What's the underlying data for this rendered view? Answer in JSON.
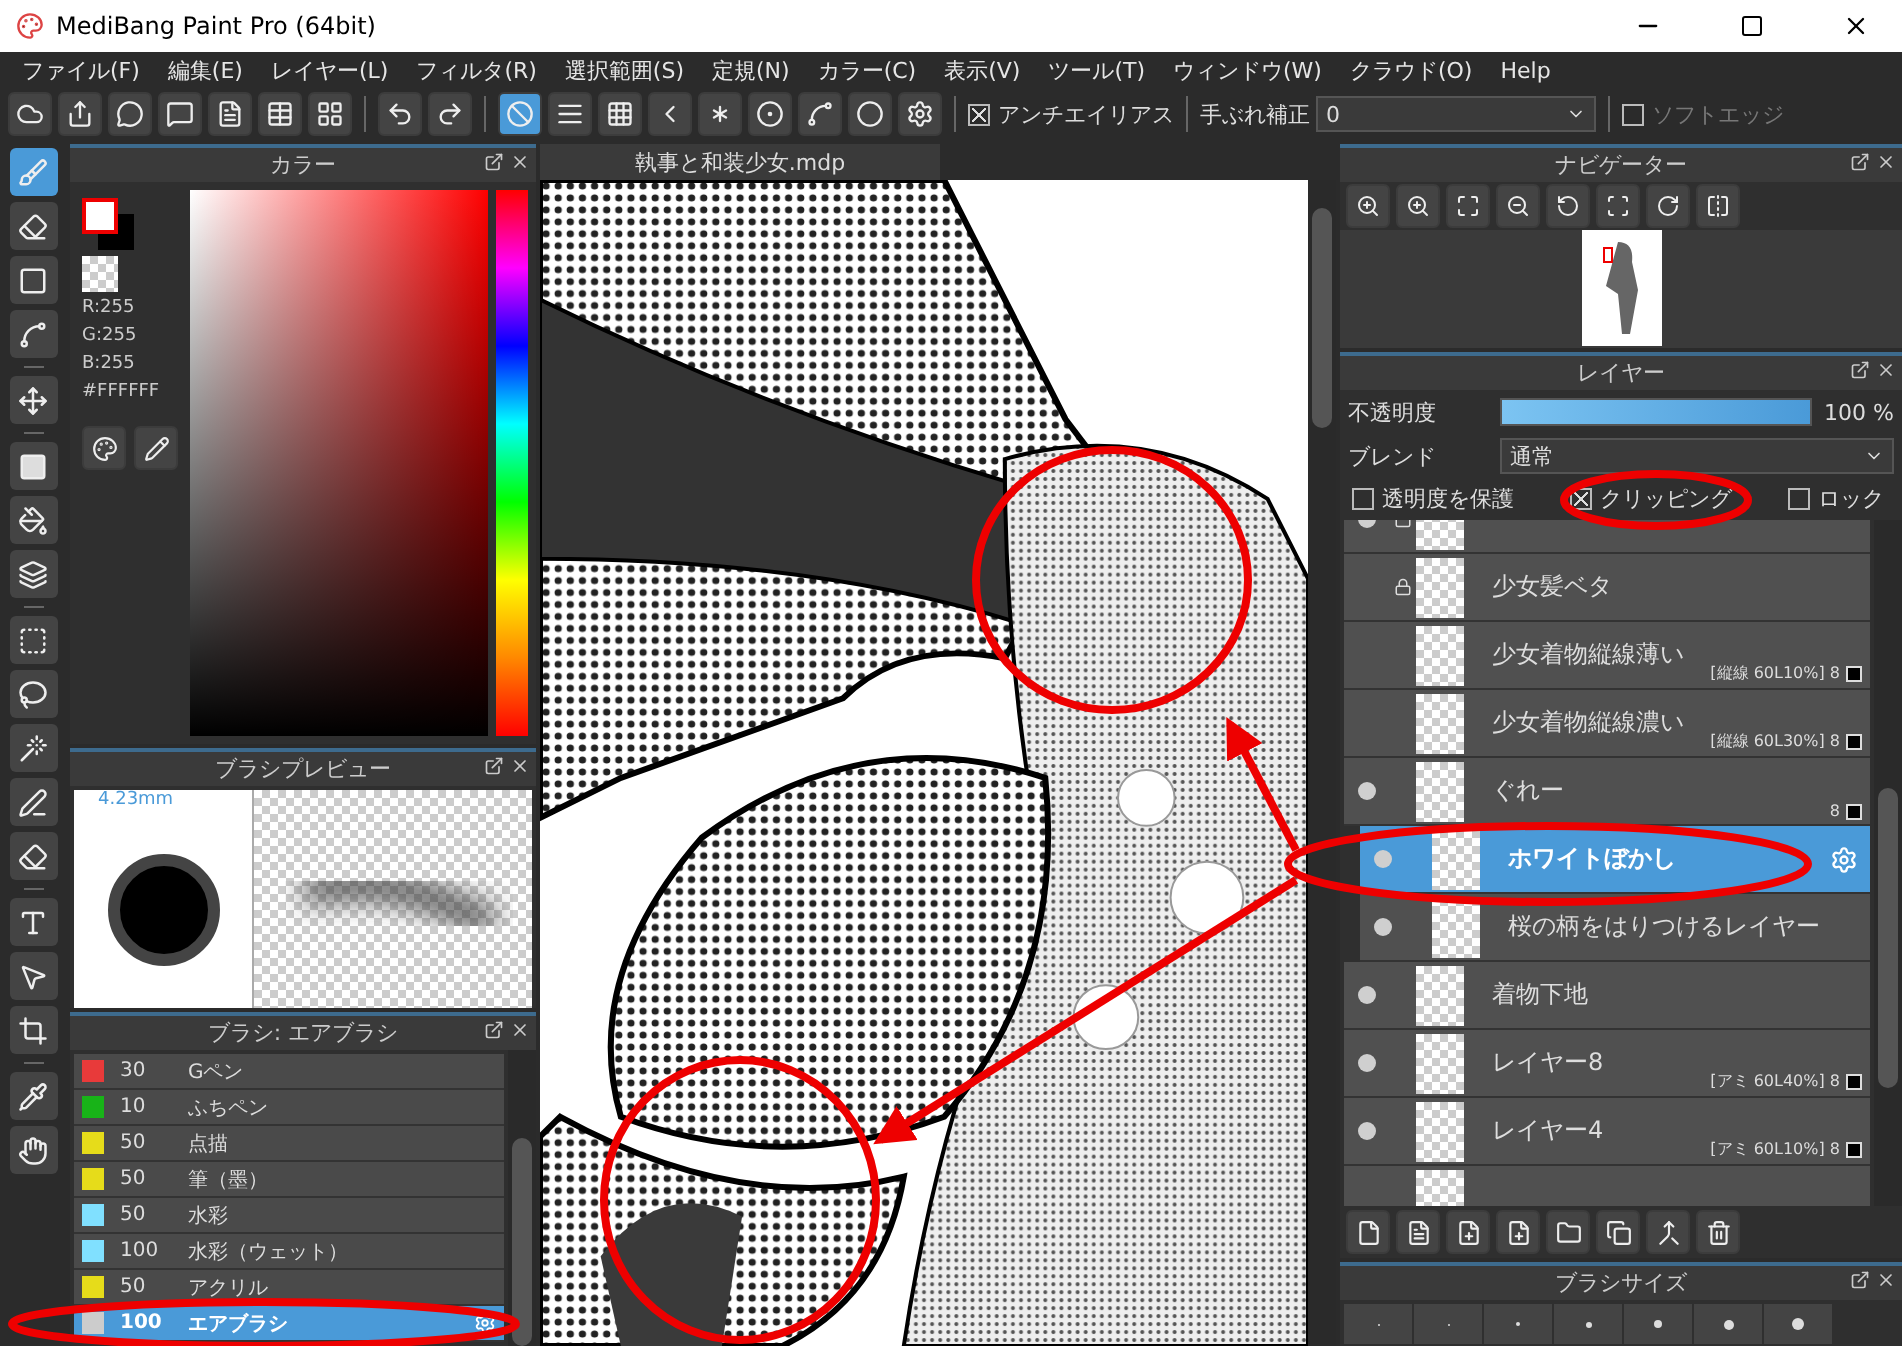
{
  "window": {
    "title": "MediBang Paint Pro (64bit)"
  },
  "menu": [
    "ファイル(F)",
    "編集(E)",
    "レイヤー(L)",
    "フィルタ(R)",
    "選択範囲(S)",
    "定規(N)",
    "カラー(C)",
    "表示(V)",
    "ツール(T)",
    "ウィンドウ(W)",
    "クラウド(O)",
    "Help"
  ],
  "toolbar": {
    "snaps": [
      {
        "kind": "off",
        "selected": true
      },
      {
        "kind": "parallel",
        "selected": false
      },
      {
        "kind": "grid",
        "selected": false
      },
      {
        "kind": "perspective",
        "selected": false
      },
      {
        "kind": "radial",
        "selected": false
      },
      {
        "kind": "concentric",
        "selected": false
      },
      {
        "kind": "curve",
        "selected": false
      },
      {
        "kind": "circle",
        "selected": false
      },
      {
        "kind": "settings",
        "selected": false
      }
    ],
    "antialias": {
      "label": "アンチエイリアス",
      "checked": true
    },
    "stabilizer": {
      "label": "手ぶれ補正",
      "value": "0"
    },
    "soft_edge": {
      "label": "ソフトエッジ",
      "checked": false
    }
  },
  "tool_groups": [
    [
      {
        "kind": "brush",
        "selected": true
      },
      {
        "kind": "eraser",
        "selected": false
      },
      {
        "kind": "dot",
        "selected": false
      },
      {
        "kind": "line",
        "selected": false
      }
    ],
    [
      {
        "kind": "move",
        "selected": false
      }
    ],
    [
      {
        "kind": "fill",
        "selected": false
      },
      {
        "kind": "bucket",
        "selected": false
      },
      {
        "kind": "gradient",
        "selected": false
      }
    ],
    [
      {
        "kind": "select",
        "selected": false
      },
      {
        "kind": "lasso",
        "selected": false
      },
      {
        "kind": "wand",
        "selected": false
      },
      {
        "kind": "select-pen",
        "selected": false
      },
      {
        "kind": "select-eraser",
        "selected": false
      }
    ],
    [
      {
        "kind": "text",
        "selected": false
      },
      {
        "kind": "operation",
        "selected": false
      },
      {
        "kind": "divide",
        "selected": false
      }
    ],
    [
      {
        "kind": "eyedropper",
        "selected": false
      },
      {
        "kind": "hand",
        "selected": false
      }
    ]
  ],
  "color_panel": {
    "title": "カラー",
    "r": "R:255",
    "g": "G:255",
    "b": "B:255",
    "hex": "#FFFFFF"
  },
  "brush_preview": {
    "title": "ブラシプレビュー",
    "size": "4.23mm"
  },
  "brush_list": {
    "title": "ブラシ: エアブラシ",
    "items": [
      {
        "color": "#e83a3a",
        "size": "30",
        "name": "Gペン",
        "selected": false
      },
      {
        "color": "#18b318",
        "size": "10",
        "name": "ふちペン",
        "selected": false
      },
      {
        "color": "#e6dc1a",
        "size": "50",
        "name": "点描",
        "selected": false
      },
      {
        "color": "#e6dc1a",
        "size": "50",
        "name": "筆（墨）",
        "selected": false
      },
      {
        "color": "#80e0ff",
        "size": "50",
        "name": "水彩",
        "selected": false
      },
      {
        "color": "#80e0ff",
        "size": "100",
        "name": "水彩（ウェット）",
        "selected": false
      },
      {
        "color": "#e6dc1a",
        "size": "50",
        "name": "アクリル",
        "selected": false
      },
      {
        "color": "#cccccc",
        "size": "100",
        "name": "エアブラシ",
        "selected": true
      }
    ]
  },
  "canvas": {
    "tab": "執事と和装少女.mdp"
  },
  "navigator": {
    "title": "ナビゲーター"
  },
  "layers": {
    "title": "レイヤー",
    "opacity_label": "不透明度",
    "opacity": {
      "level": 1
    },
    "opacity_value": "100 %",
    "blend_label": "ブレンド",
    "blend_value": "通常",
    "options": [
      {
        "label": "透明度を保護",
        "checked": false
      },
      {
        "label": "クリッピング",
        "checked": true
      },
      {
        "label": "ロック",
        "checked": false
      }
    ],
    "items": [
      {
        "visible": true,
        "locked": true,
        "clipped": false,
        "selected": false
      },
      {
        "name": "少女髪ベタ",
        "visible": false,
        "locked": true,
        "clipped": false,
        "selected": false
      },
      {
        "name": "少女着物縦線薄い",
        "visible": false,
        "locked": false,
        "clipped": false,
        "selected": false,
        "tag": "[縦線 60L10%] 8"
      },
      {
        "name": "少女着物縦線濃い",
        "visible": false,
        "locked": false,
        "clipped": false,
        "selected": false,
        "tag": "[縦線 60L30%] 8"
      },
      {
        "name": "ぐれー",
        "visible": true,
        "locked": false,
        "clipped": false,
        "selected": false,
        "tag": "8"
      },
      {
        "name": "ホワイトぼかし",
        "visible": true,
        "locked": false,
        "clipped": true,
        "selected": true
      },
      {
        "name": "桜の柄をはりつけるレイヤー",
        "visible": true,
        "locked": false,
        "clipped": true,
        "selected": false
      },
      {
        "name": "着物下地",
        "visible": true,
        "locked": false,
        "clipped": false,
        "selected": false
      },
      {
        "name": "レイヤー8",
        "visible": true,
        "locked": false,
        "clipped": false,
        "selected": false,
        "tag": "[アミ 60L40%] 8"
      },
      {
        "name": "レイヤー4",
        "visible": true,
        "locked": false,
        "clipped": false,
        "selected": false,
        "tag": "[アミ 60L10%] 8"
      },
      {
        "visible": false,
        "locked": false,
        "clipped": false,
        "selected": false
      }
    ]
  },
  "brush_size": {
    "title": "ブラシサイズ"
  }
}
